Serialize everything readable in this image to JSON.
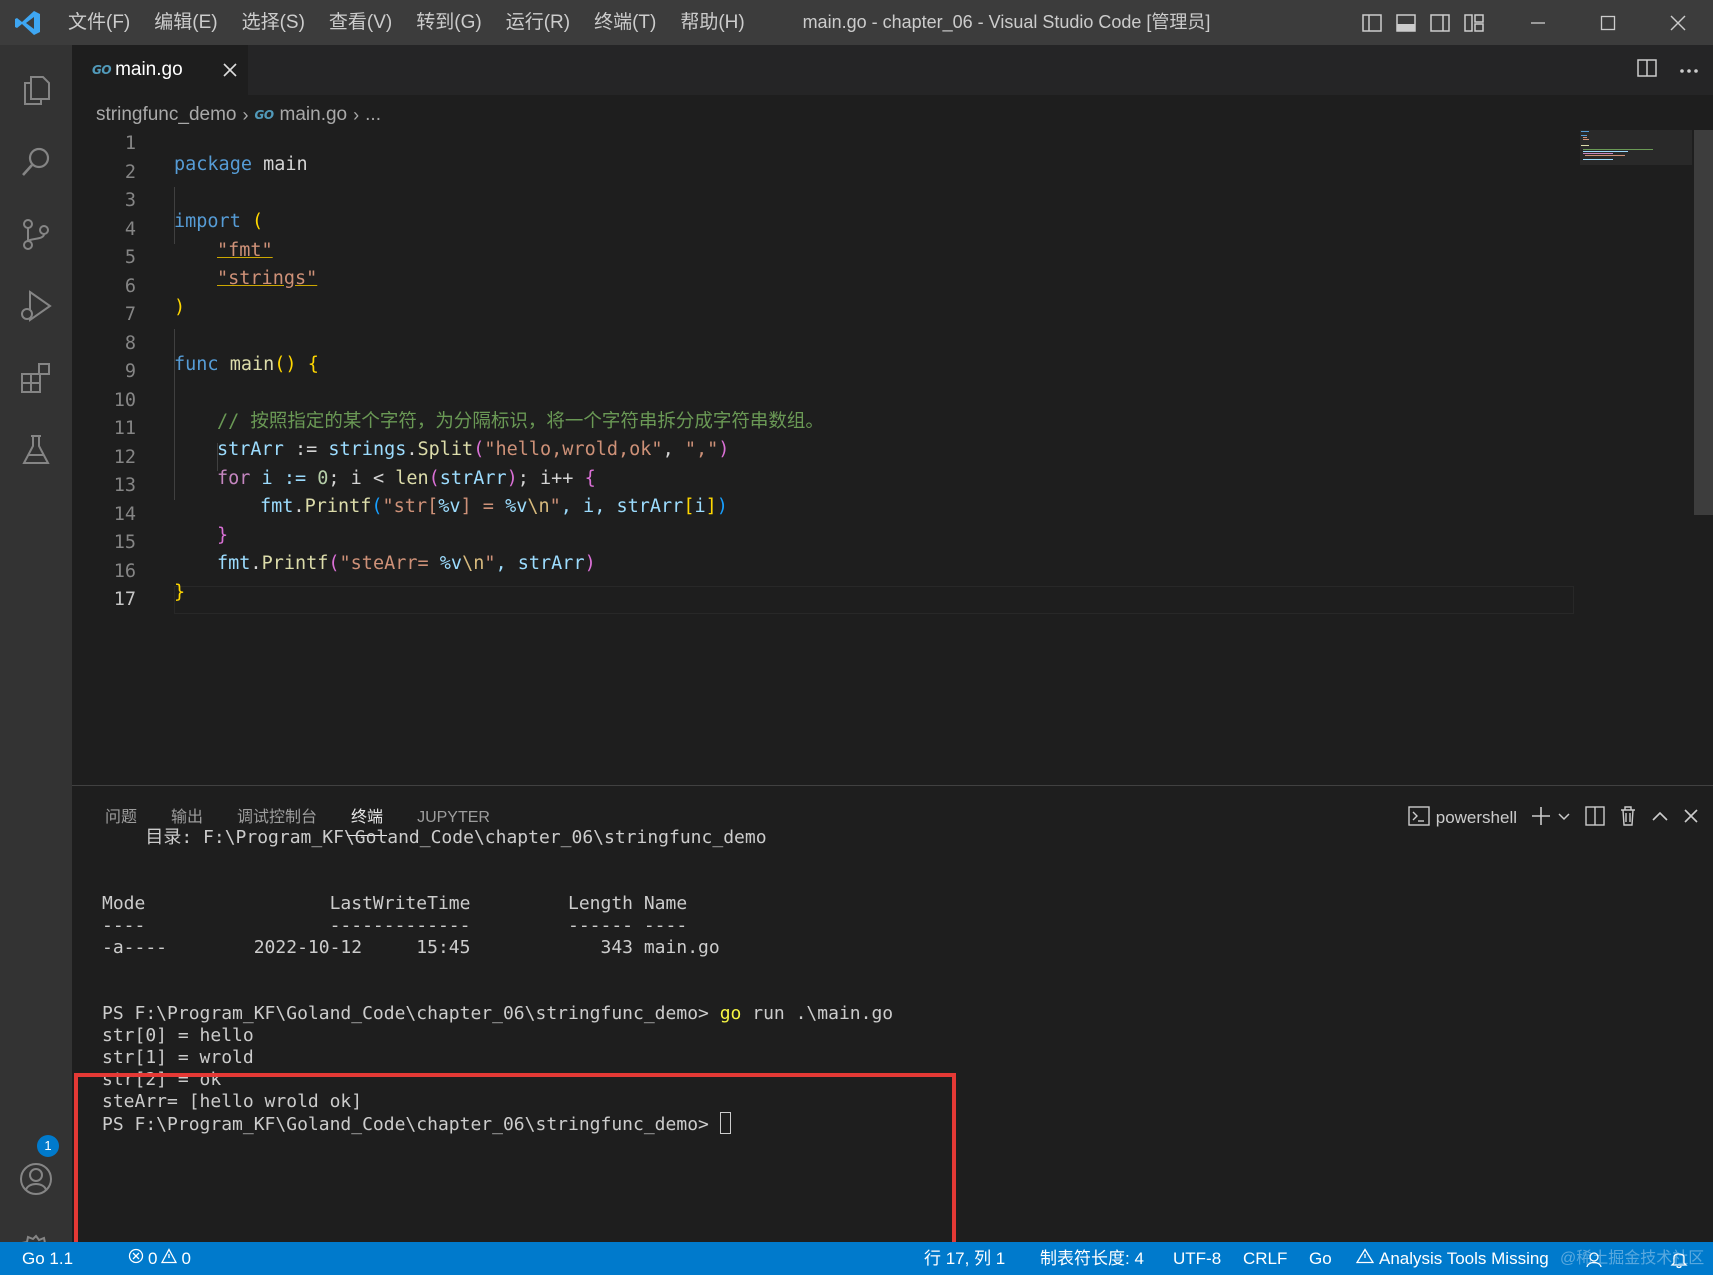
{
  "titlebar": {
    "menus": [
      "文件(F)",
      "编辑(E)",
      "选择(S)",
      "查看(V)",
      "转到(G)",
      "运行(R)",
      "终端(T)",
      "帮助(H)"
    ],
    "window_title": "main.go - chapter_06 - Visual Studio Code [管理员]"
  },
  "tab": {
    "icon_text": "GO",
    "name": "main.go"
  },
  "breadcrumb": {
    "folder": "stringfunc_demo",
    "file": "main.go",
    "more": "..."
  },
  "code": {
    "line_numbers": [
      "1",
      "2",
      "3",
      "4",
      "5",
      "6",
      "7",
      "8",
      "9",
      "10",
      "11",
      "12",
      "13",
      "14",
      "15",
      "16",
      "17"
    ],
    "lines": {
      "l1": {
        "kw": "package",
        "rest": "main"
      },
      "l3": {
        "kw": "import",
        "paren": "("
      },
      "l4": {
        "str": "\"fmt\""
      },
      "l5": {
        "str": "\"strings\""
      },
      "l6": {
        "paren": ")"
      },
      "l8": {
        "kw": "func",
        "fn": "main",
        "p1": "()",
        "brace": "{"
      },
      "l10": {
        "comment": "// 按照指定的某个字符，为分隔标识，将一个字符串拆分成字符串数组。"
      },
      "l11": {
        "var": "strArr",
        "op": " := ",
        "pkg": "strings",
        "dot": ".",
        "fn": "Split",
        "open": "(",
        "s1": "\"hello,wrold,ok\"",
        "comma": ", ",
        "s2": "\",\"",
        "close": ")"
      },
      "l12": {
        "kw": "for",
        "a": " i := ",
        "num": "0",
        "b": "; i < ",
        "fn": "len",
        "open": "(",
        "c": "strArr",
        "close": ")",
        "d": "; i++ ",
        "brace": "{"
      },
      "l13": {
        "pkg": "fmt",
        "dot": ".",
        "fn": "Printf",
        "open": "(",
        "s_a": "\"str[",
        "e1": "%v",
        "s_b": "] = ",
        "e2": "%v",
        "e3": "\\n",
        "s_c": "\"",
        "d": ", i, strArr",
        "sq_o": "[",
        "i": "i",
        "sq_c": "]",
        "close": ")"
      },
      "l14": {
        "brace": "}"
      },
      "l15": {
        "pkg": "fmt",
        "dot": ".",
        "fn": "Printf",
        "open": "(",
        "s_a": "\"steArr= ",
        "e1": "%v",
        "e2": "\\n",
        "s_c": "\"",
        "d": ", strArr",
        "close": ")"
      },
      "l16": {
        "brace": "}"
      }
    }
  },
  "panel": {
    "tabs": [
      "问题",
      "输出",
      "调试控制台",
      "终端",
      "JUPYTER"
    ],
    "active_tab": "终端",
    "shell": "powershell",
    "terminal": {
      "dir_line": "    目录: F:\\Program_KF\\Goland_Code\\chapter_06\\stringfunc_demo",
      "header": "Mode                 LastWriteTime         Length Name",
      "dashes": "----                 -------------         ------ ----",
      "entry": "-a----        2022-10-12     15:45            343 main.go",
      "prompt1": "PS F:\\Program_KF\\Goland_Code\\chapter_06\\stringfunc_demo> ",
      "cmd_go": "go",
      "cmd_rest": " run .\\main.go",
      "out1": "str[0] = hello",
      "out2": "str[1] = wrold",
      "out3": "str[2] = ok",
      "out4": "steArr= [hello wrold ok]",
      "prompt2": "PS F:\\Program_KF\\Goland_Code\\chapter_06\\stringfunc_demo> "
    }
  },
  "statusbar": {
    "go_version": "Go 1.1",
    "errors": "0",
    "warnings": "0",
    "position": "行 17, 列 1",
    "indent": "制表符长度: 4",
    "encoding": "UTF-8",
    "eol": "CRLF",
    "language": "Go",
    "analysis": "Analysis Tools Missing"
  },
  "accounts_badge": "1",
  "watermark": "@稀土掘金技术社区",
  "colors": {
    "accent": "#007acc",
    "highlight_box": "#e53935"
  },
  "icons": [
    "vscode-logo-icon",
    "explorer-icon",
    "search-icon",
    "source-control-icon",
    "run-debug-icon",
    "extensions-icon",
    "testing-icon",
    "accounts-icon",
    "settings-gear-icon",
    "close-icon",
    "split-editor-icon",
    "more-icon",
    "terminal-icon",
    "plus-icon",
    "chevron-down-icon",
    "trash-icon",
    "chevron-up-icon",
    "error-icon",
    "warning-icon",
    "bell-icon"
  ]
}
